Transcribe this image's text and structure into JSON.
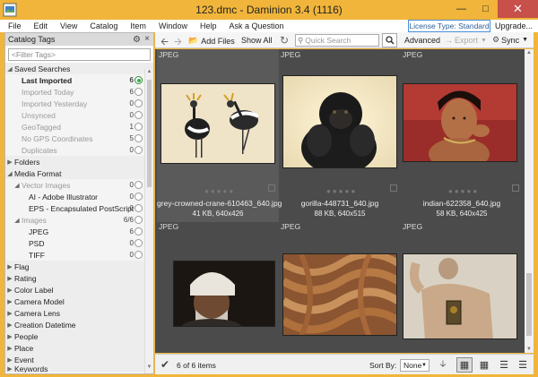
{
  "window": {
    "title": "123.dmc - Daminion 3.4 (1116)"
  },
  "menu": [
    "File",
    "Edit",
    "View",
    "Catalog",
    "Item",
    "Window",
    "Help",
    "Ask a Question"
  ],
  "license": {
    "label": "License Type: Standard",
    "upgrade": "Upgrade..."
  },
  "left_panel": {
    "title": "Catalog Tags",
    "filter_placeholder": "<Filter Tags>",
    "saved_searches": {
      "label": "Saved Searches",
      "items": [
        {
          "label": "Last Imported",
          "count": "6",
          "selected": true
        },
        {
          "label": "Imported Today",
          "count": "6"
        },
        {
          "label": "Imported Yesterday",
          "count": "0"
        },
        {
          "label": "Unsynced",
          "count": "0"
        },
        {
          "label": "GeoTagged",
          "count": "1"
        },
        {
          "label": "No GPS Coordinates",
          "count": "5"
        },
        {
          "label": "Duplicates",
          "count": "0"
        }
      ]
    },
    "folders": "Folders",
    "media_format": {
      "label": "Media Format",
      "vector": {
        "label": "Vector Images",
        "count": "0"
      },
      "vector_items": [
        {
          "label": "AI - Adobe Illustrator",
          "count": "0"
        },
        {
          "label": "EPS - Encapsulated PostScript",
          "count": "0"
        }
      ],
      "images": {
        "label": "Images",
        "count": "6/6"
      },
      "image_items": [
        {
          "label": "JPEG",
          "count": "6"
        },
        {
          "label": "PSD",
          "count": "0"
        },
        {
          "label": "TIFF",
          "count": "0"
        }
      ]
    },
    "groups": [
      "Flag",
      "Rating",
      "Color Label",
      "Camera Model",
      "Camera Lens",
      "Creation Datetime",
      "People",
      "Place",
      "Event",
      "Keywords"
    ]
  },
  "toolbar": {
    "add_files": "Add Files",
    "show_all": "Show All",
    "search_placeholder": "Quick Search",
    "advanced": "Advanced",
    "export": "Export",
    "sync": "Sync"
  },
  "items": [
    {
      "format": "JPEG",
      "name": "grey-crowned-crane-610463_640.jpg",
      "info": "41 KB, 640x426"
    },
    {
      "format": "JPEG",
      "name": "gorilla-448731_640.jpg",
      "info": "88 KB, 640x515"
    },
    {
      "format": "JPEG",
      "name": "indian-622358_640.jpg",
      "info": "58 KB, 640x425"
    },
    {
      "format": "JPEG",
      "name": "",
      "info": ""
    },
    {
      "format": "JPEG",
      "name": "",
      "info": ""
    },
    {
      "format": "JPEG",
      "name": "",
      "info": ""
    }
  ],
  "status": {
    "count": "6 of 6 items",
    "sort_by_label": "Sort By:",
    "sort_value": "None"
  },
  "colors": {
    "title_bar": "#f0b53a",
    "grid_bg": "#4b4b4b",
    "close": "#c7504a"
  }
}
